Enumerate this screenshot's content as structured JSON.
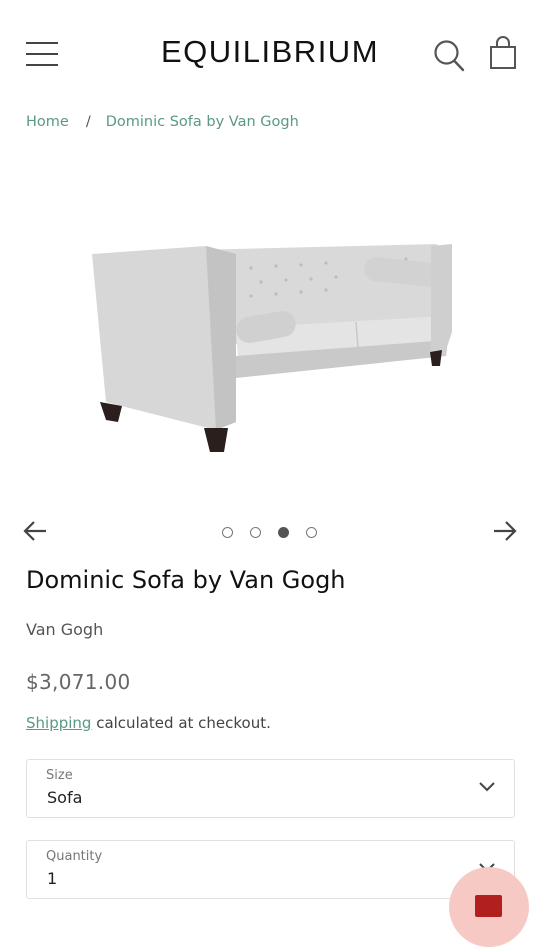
{
  "header": {
    "logo": "EQUILIBRIUM",
    "menu_icon": "hamburger-menu-icon",
    "search_icon": "search-icon",
    "cart_icon": "shopping-bag-icon"
  },
  "breadcrumb": {
    "home": "Home",
    "separator": "/",
    "current": "Dominic Sofa by Van Gogh"
  },
  "gallery": {
    "slide_count": 4,
    "active_slide": 3,
    "prev_icon": "arrow-left-icon",
    "next_icon": "arrow-right-icon"
  },
  "product": {
    "title": "Dominic Sofa by Van Gogh",
    "vendor": "Van Gogh",
    "price": "$3,071.00",
    "shipping_link": "Shipping",
    "shipping_text": " calculated at checkout."
  },
  "options": {
    "size_label": "Size",
    "size_value": "Sofa",
    "quantity_label": "Quantity",
    "quantity_value": "1"
  },
  "colors": {
    "accent": "#5a9a80",
    "chat_bubble": "#f7c9c4",
    "chat_icon": "#b11f1f"
  }
}
